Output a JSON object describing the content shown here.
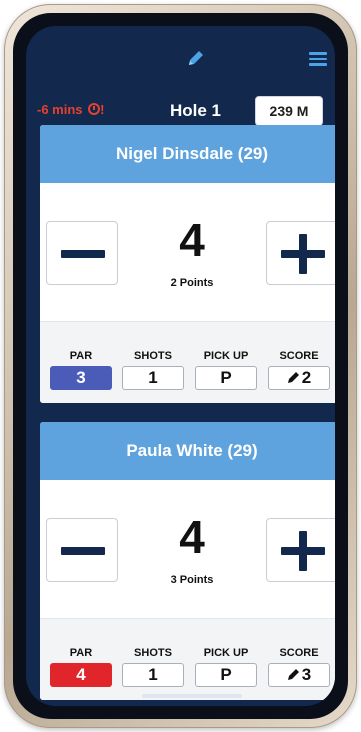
{
  "header": {
    "pencil_icon": "pencil-icon",
    "menu_icon": "hamburger-menu-icon",
    "timer": "-6 mins",
    "timer_icon": "clock-icon",
    "timer_mark": "!",
    "hole": "Hole 1",
    "distance": "239 M"
  },
  "colors": {
    "screen_bg": "#12294d",
    "card_header": "#5fa3de",
    "timer_red": "#e8402f",
    "par_blue": "#4a5cb8",
    "par_red": "#e0262b"
  },
  "players": [
    {
      "name": "Nigel Dinsdale (29)",
      "score": "4",
      "points": "2 Points",
      "par_label": "PAR",
      "par": "3",
      "par_color": "#4a5cb8",
      "shots_label": "SHOTS",
      "shots": "1",
      "pickup_label": "PICK UP",
      "pickup": "P",
      "score_label": "SCORE",
      "score_value": "2"
    },
    {
      "name": "Paula White (29)",
      "score": "4",
      "points": "3 Points",
      "par_label": "PAR",
      "par": "4",
      "par_color": "#e0262b",
      "shots_label": "SHOTS",
      "shots": "1",
      "pickup_label": "PICK UP",
      "pickup": "P",
      "score_label": "SCORE",
      "score_value": "3"
    }
  ]
}
